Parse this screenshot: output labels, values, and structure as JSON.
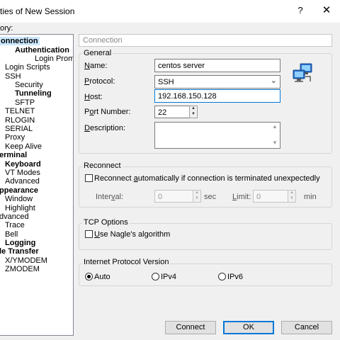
{
  "window": {
    "title": "ties of New Session",
    "help_glyph": "?",
    "close_glyph": "✕"
  },
  "category_label": "ory:",
  "tree": [
    {
      "label": "onnection",
      "bold": true,
      "selected": true
    },
    {
      "label": "Authentication",
      "bold": true
    },
    {
      "label": "Login Prompts"
    },
    {
      "label": "Login Scripts"
    },
    {
      "label": "SSH"
    },
    {
      "label": "Security"
    },
    {
      "label": "Tunneling",
      "bold": true
    },
    {
      "label": "SFTP"
    },
    {
      "label": "TELNET"
    },
    {
      "label": "RLOGIN"
    },
    {
      "label": "SERIAL"
    },
    {
      "label": "Proxy"
    },
    {
      "label": "Keep Alive"
    },
    {
      "label": "erminal",
      "bold": true
    },
    {
      "label": "Keyboard",
      "bold": true
    },
    {
      "label": "VT Modes"
    },
    {
      "label": "Advanced"
    },
    {
      "label": "ppearance",
      "bold": true
    },
    {
      "label": "Window"
    },
    {
      "label": "Highlight"
    },
    {
      "label": "dvanced"
    },
    {
      "label": "Trace"
    },
    {
      "label": "Bell"
    },
    {
      "label": "Logging",
      "bold": true
    },
    {
      "label": "le Transfer",
      "bold": true
    },
    {
      "label": "X/YMODEM"
    },
    {
      "label": "ZMODEM"
    }
  ],
  "panel_title": "Connection",
  "general": {
    "title": "General",
    "name_label": "Name:",
    "name_value": "centos server",
    "protocol_label": "Protocol:",
    "protocol_value": "SSH",
    "host_label": "Host:",
    "host_value": "192.168.150.128",
    "port_label": "Port Number:",
    "port_value": "22",
    "description_label": "Description:",
    "description_value": ""
  },
  "reconnect": {
    "title": "Reconnect",
    "checkbox_label": "Reconnect automatically if connection is terminated unexpectedly",
    "checked": false,
    "interval_label": "Interval:",
    "interval_value": "0",
    "interval_unit": "sec",
    "limit_label": "Limit:",
    "limit_value": "0",
    "limit_unit": "min"
  },
  "tcp": {
    "title": "TCP Options",
    "nagle_label": "Use Nagle's algorithm",
    "checked": false
  },
  "ip_version": {
    "title": "Internet Protocol Version",
    "options": [
      "Auto",
      "IPv4",
      "IPv6"
    ],
    "selected": "Auto"
  },
  "buttons": {
    "connect": "Connect",
    "ok": "OK",
    "cancel": "Cancel"
  }
}
